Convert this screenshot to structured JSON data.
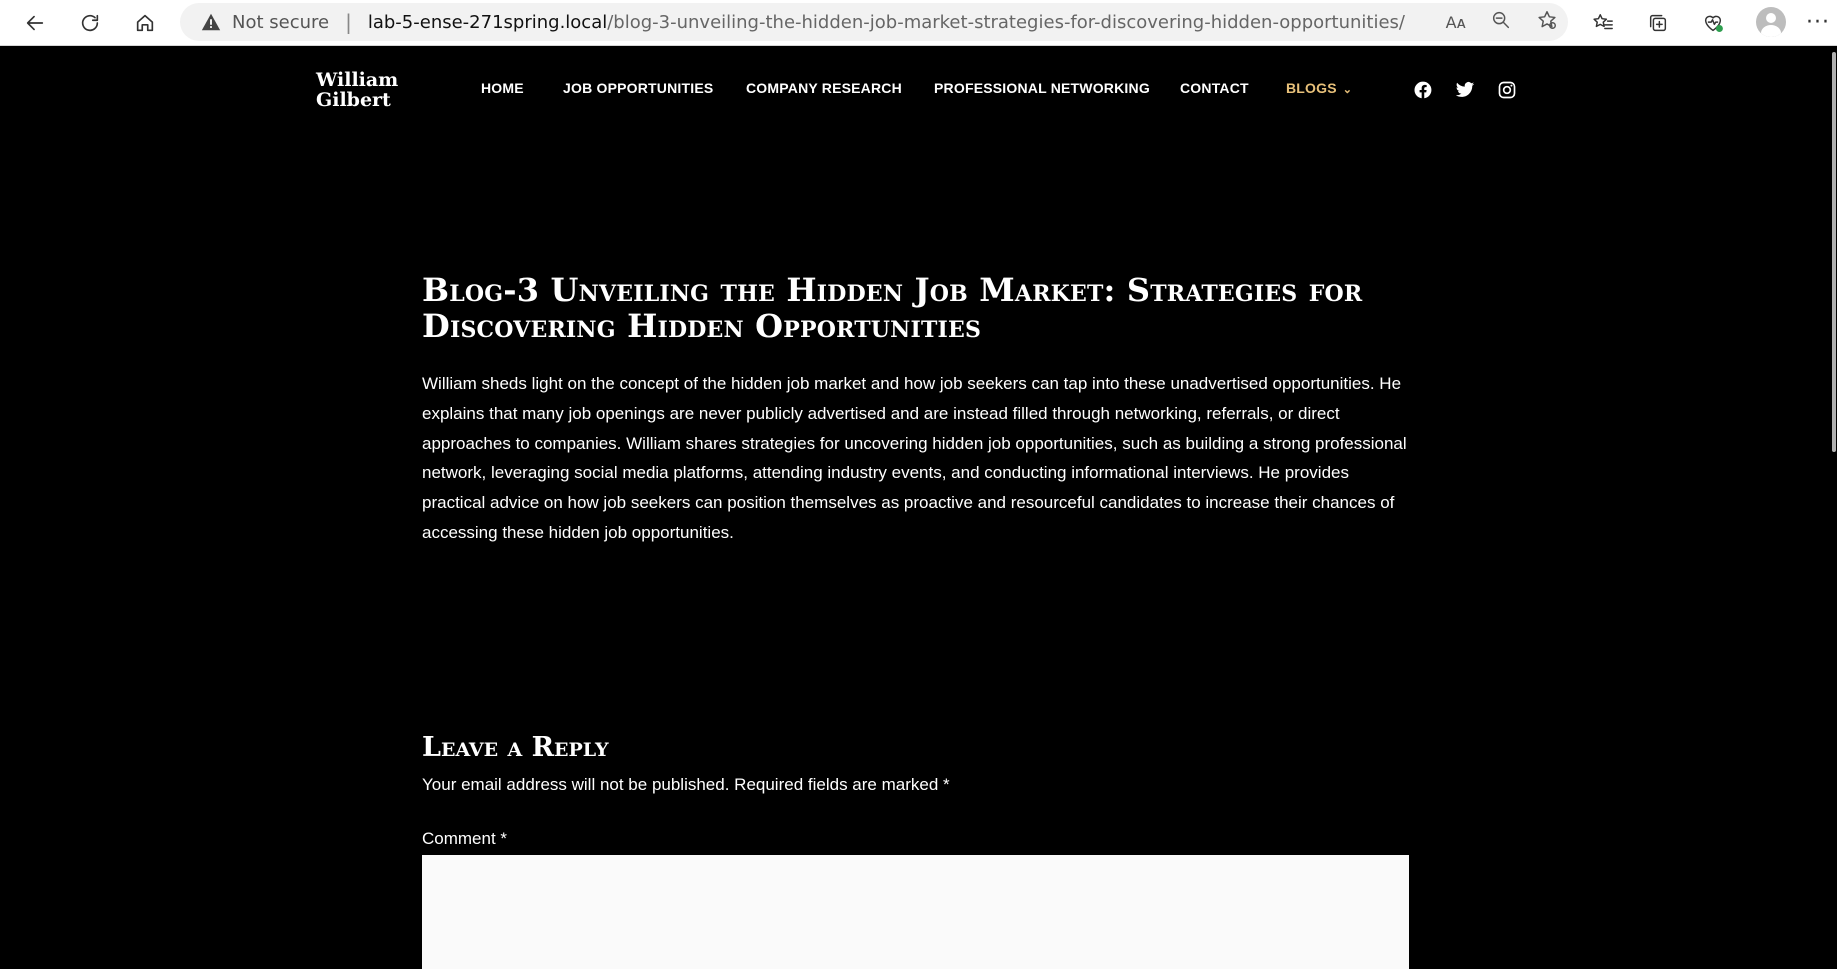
{
  "browser": {
    "security_label": "Not secure",
    "url_host": "lab-5-ense-271spring.local",
    "url_path": "/blog-3-unveiling-the-hidden-job-market-strategies-for-discovering-hidden-opportunities/",
    "read_aloud_glyph": "Aᴀ",
    "icons": [
      "back-icon",
      "refresh-icon",
      "home-icon",
      "warning-icon",
      "read-aloud-icon",
      "zoom-out-icon",
      "add-favorite-icon",
      "favorites-icon",
      "collections-icon",
      "browser-essentials-icon",
      "profile-icon",
      "more-icon"
    ],
    "more_glyph": "···"
  },
  "site": {
    "logo_line1": "William",
    "logo_line2": "Gilbert",
    "menu": [
      {
        "label": "HOME"
      },
      {
        "label": "JOB OPPORTUNITIES"
      },
      {
        "label": "COMPANY RESEARCH"
      },
      {
        "label": "PROFESSIONAL NETWORKING"
      },
      {
        "label": "CONTACT"
      },
      {
        "label": "BLOGS",
        "active": true
      }
    ],
    "menu_active_color": "#e8c17a",
    "social": [
      "facebook-icon",
      "twitter-icon",
      "instagram-icon"
    ]
  },
  "post": {
    "title_line1": "Blog-3 Unveiling the Hidden Job Market: Strategies for",
    "title_line2": "Discovering Hidden Opportunities",
    "body": "William sheds light on the concept of the hidden job market and how job seekers can tap into these unadvertised opportunities. He explains that many job openings are never publicly advertised and are instead filled through networking, referrals, or direct approaches to companies. William shares strategies for uncovering hidden job opportunities, such as building a strong professional network, leveraging social media platforms, attending industry events, and conducting informational interviews. He provides practical advice on how job seekers can position themselves as proactive and resourceful candidates to increase their chances of accessing these hidden job opportunities."
  },
  "reply": {
    "title": "Leave a Reply",
    "notes": "Your email address will not be published. Required fields are marked *",
    "comment_label": "Comment *",
    "comment_value": ""
  }
}
